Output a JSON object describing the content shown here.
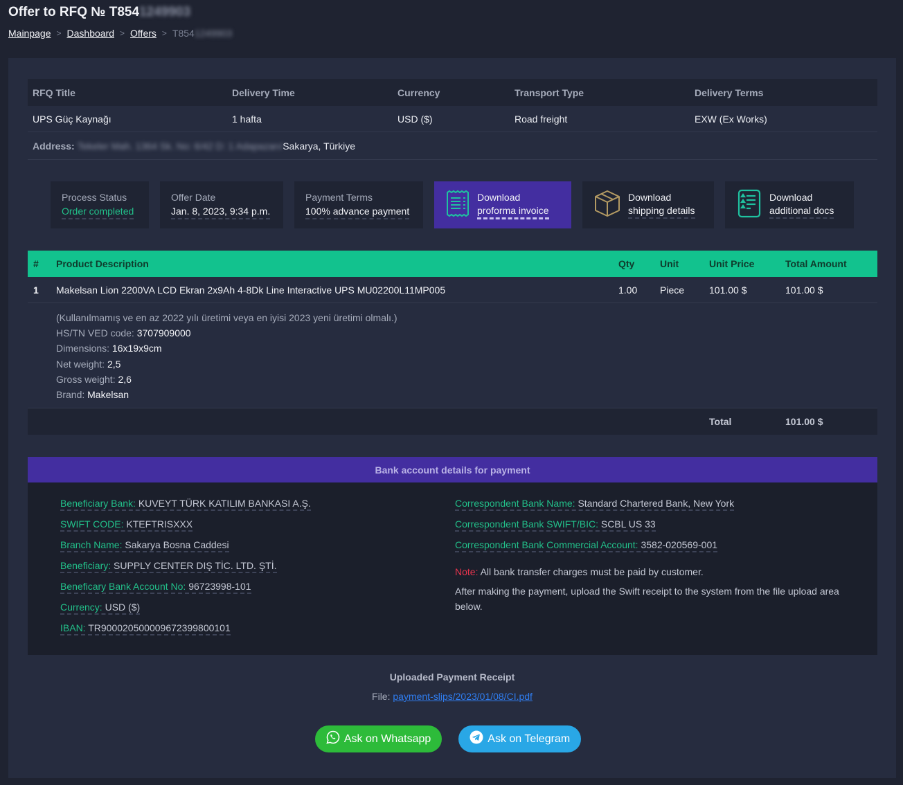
{
  "header": {
    "title_prefix": "Offer to RFQ № T854",
    "title_redacted": "1249903",
    "breadcrumb": {
      "items": [
        "Mainpage",
        "Dashboard",
        "Offers"
      ],
      "separator": ">",
      "current_prefix": "T854",
      "current_redacted": "1249903"
    }
  },
  "rfq": {
    "headers": [
      "RFQ Title",
      "Delivery Time",
      "Currency",
      "Transport Type",
      "Delivery Terms"
    ],
    "values": [
      "UPS Güç Kaynağı",
      "1 hafta",
      "USD ($)",
      "Road freight",
      "EXW (Ex Works)"
    ],
    "address_label": "Address:",
    "address_redacted": "Tekeler Mah. 1364 Sk. No: 6/42 D: 1 Adapazarı/",
    "address_visible": "Sakarya, Türkiye"
  },
  "cards": {
    "process_status": {
      "label": "Process Status",
      "value": "Order completed"
    },
    "offer_date": {
      "label": "Offer Date",
      "value": "Jan. 8, 2023, 9:34 p.m."
    },
    "payment_terms": {
      "label": "Payment Terms",
      "value": "100% advance payment"
    }
  },
  "downloads": [
    {
      "line1": "Download",
      "line2": "proforma invoice",
      "icon": "invoice-icon"
    },
    {
      "line1": "Download",
      "line2": "shipping details",
      "icon": "box-icon"
    },
    {
      "line1": "Download",
      "line2": "additional docs",
      "icon": "document-list-icon"
    }
  ],
  "products": {
    "headers": [
      "#",
      "Product Description",
      "Qty",
      "Unit",
      "Unit Price",
      "Total Amount"
    ],
    "rows": [
      {
        "num": "1",
        "description": "Makelsan Lion 2200VA LCD Ekran 2x9Ah 4-8Dk Line Interactive UPS MU02200L11MP005",
        "qty": "1.00",
        "unit": "Piece",
        "unit_price": "101.00 $",
        "total": "101.00 $",
        "note": "(Kullanılmamış ve en az 2022 yılı üretimi veya en iyisi 2023 yeni üretimi olmalı.)",
        "details": [
          {
            "label": "HS/TN VED code:",
            "value": "3707909000"
          },
          {
            "label": "Dimensions:",
            "value": "16x19x9cm"
          },
          {
            "label": "Net weight:",
            "value": "2,5"
          },
          {
            "label": "Gross weight:",
            "value": "2,6"
          },
          {
            "label": "Brand:",
            "value": "Makelsan"
          }
        ]
      }
    ],
    "total_label": "Total",
    "total_value": "101.00 $"
  },
  "bank": {
    "title": "Bank account details for payment",
    "left": [
      {
        "k": "Beneficiary Bank:",
        "v": "KUVEYT TÜRK KATILIM BANKASI A.Ş."
      },
      {
        "k": "SWIFT CODE:",
        "v": "KTEFTRISXXX"
      },
      {
        "k": "Branch Name:",
        "v": "Sakarya Bosna Caddesi"
      },
      {
        "k": "Beneficiary:",
        "v": "SUPPLY CENTER DIŞ TİC. LTD. ŞTİ."
      },
      {
        "k": "Beneficary Bank Account No:",
        "v": "96723998-101"
      },
      {
        "k": "Currency:",
        "v": "USD ($)"
      },
      {
        "k": "IBAN:",
        "v": "TR900020500009672399800101"
      }
    ],
    "right": [
      {
        "k": "Correspondent Bank Name:",
        "v": "Standard Chartered Bank, New York"
      },
      {
        "k": "Correspondent Bank SWIFT/BIC:",
        "v": "SCBL US 33"
      },
      {
        "k": "Correspondent Bank Commercial Account:",
        "v": "3582-020569-001"
      }
    ],
    "note_label": "Note:",
    "note_text": "All bank transfer charges must be paid by customer.",
    "instruction": "After making the payment, upload the Swift receipt to the system from the file upload area below."
  },
  "receipt": {
    "title": "Uploaded Payment Receipt",
    "file_label": "File:",
    "file_link": "payment-slips/2023/01/08/CI.pdf"
  },
  "buttons": {
    "whatsapp": "Ask on Whatsapp",
    "telegram": "Ask on Telegram"
  },
  "colors": {
    "accent_green": "#12c28e",
    "accent_purple": "#432ea0",
    "note_red": "#e8344e",
    "link_blue": "#2f7df0",
    "whatsapp_green": "#2dbb3a",
    "telegram_blue": "#29a7e6"
  }
}
